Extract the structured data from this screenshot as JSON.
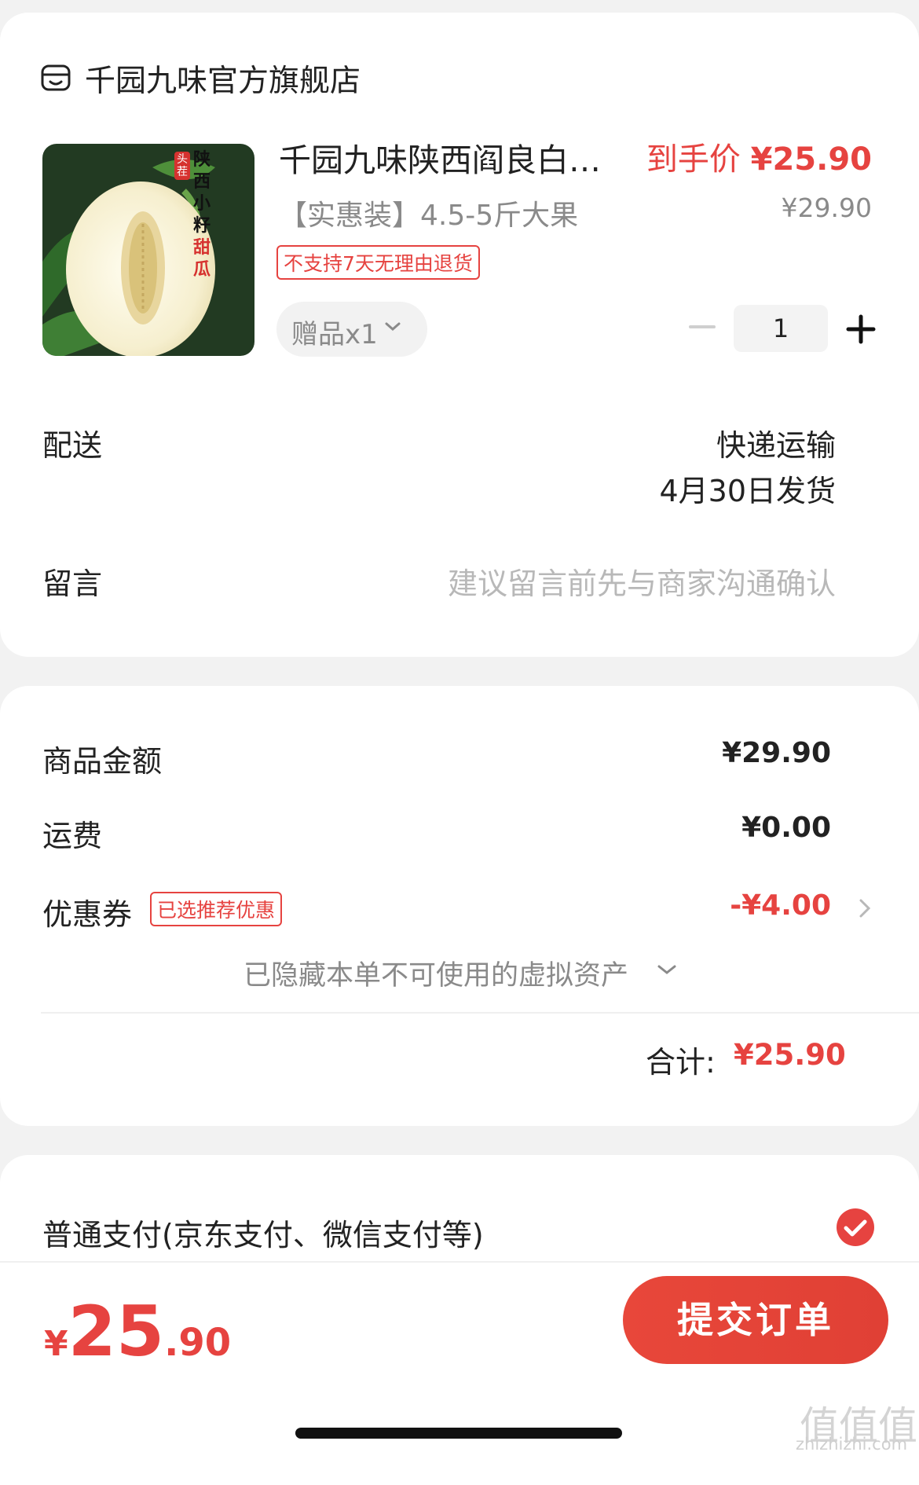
{
  "store": {
    "name": "千园九味官方旗舰店",
    "icon": "store-icon"
  },
  "product": {
    "thumb_text": [
      "陕",
      "西",
      "小",
      "籽",
      "甜",
      "瓜"
    ],
    "thumb_tag": "头茬",
    "title": "千园九味陕西阎良白…",
    "spec": "【实惠装】4.5-5斤大果",
    "return_badge": "不支持7天无理由退货",
    "gift_label": "赠品x1",
    "deal_price_label": "到手价",
    "deal_price": "¥25.90",
    "original_price": "¥29.90",
    "quantity": "1"
  },
  "delivery": {
    "label": "配送",
    "method": "快递运输",
    "date": "4月30日发货"
  },
  "note": {
    "label": "留言",
    "placeholder": "建议留言前先与商家沟通确认"
  },
  "amounts": {
    "goods_label": "商品金额",
    "goods_value": "¥29.90",
    "shipping_label": "运费",
    "shipping_value": "¥0.00",
    "coupon_label": "优惠券",
    "coupon_badge": "已选推荐优惠",
    "coupon_value": "-¥4.00",
    "hidden_assets": "已隐藏本单不可使用的虚拟资产",
    "total_label": "合计:",
    "total_value": "¥25.90"
  },
  "payment": {
    "label": "普通支付(京东支付、微信支付等)",
    "selected": true
  },
  "footer": {
    "price_yen": "¥",
    "price_int": "25",
    "price_dec": ".90",
    "submit_label": "提交订单"
  },
  "watermark": {
    "main": "值值值",
    "sub": "zhizhizhi.com"
  },
  "colors": {
    "accent": "#e64340",
    "muted": "#8a8a8a",
    "placeholder": "#b8b8b8",
    "background": "#f2f2f2"
  }
}
